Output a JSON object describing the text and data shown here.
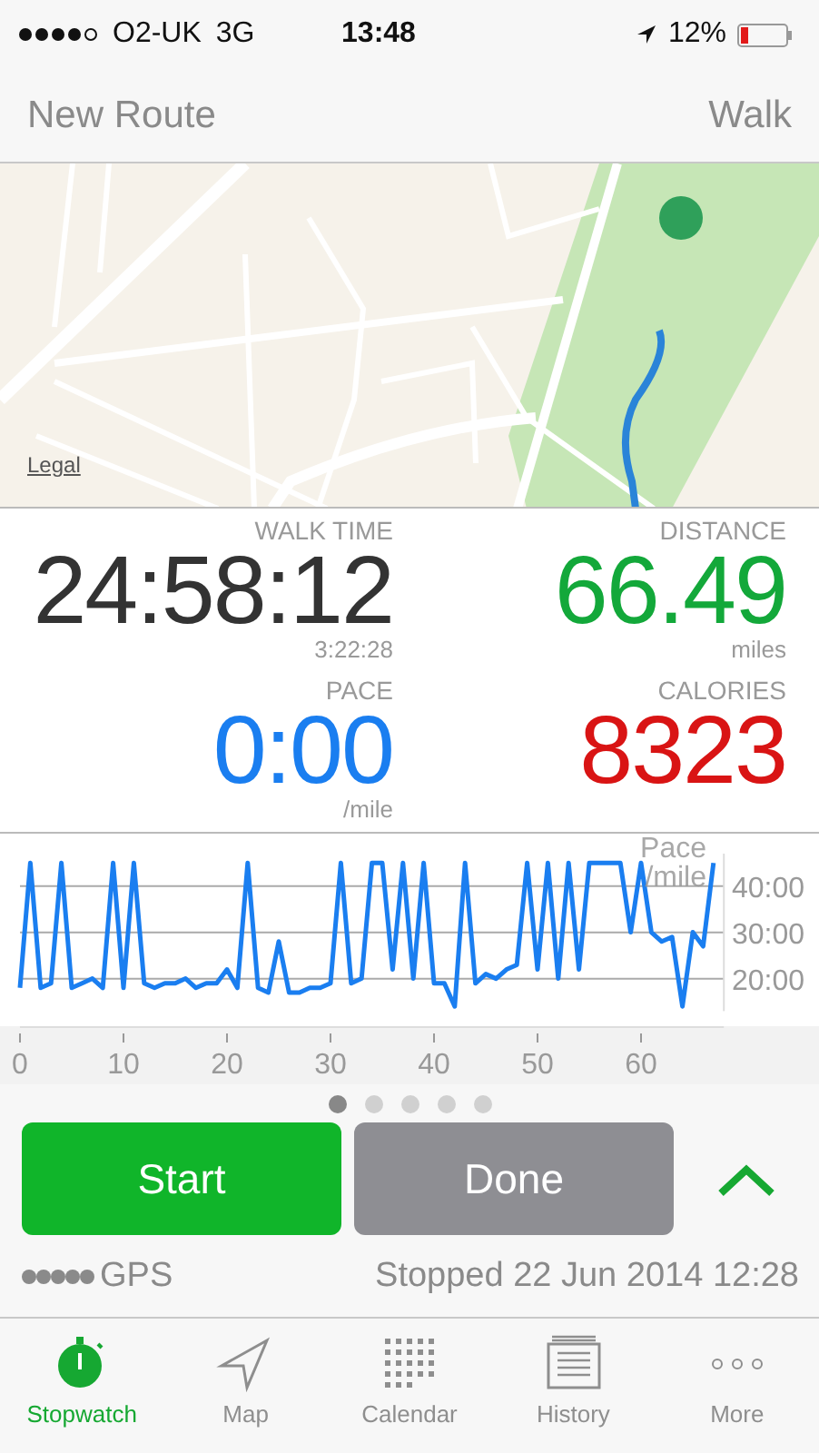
{
  "status_bar": {
    "carrier": "O2-UK",
    "network": "3G",
    "time": "13:48",
    "battery": "12%"
  },
  "nav": {
    "title": "New Route",
    "activity": "Walk"
  },
  "map": {
    "kind": "picture",
    "legal_link": "Legal"
  },
  "stats": [
    {
      "label": "WALK TIME",
      "value": "24:58:12",
      "sub": "3:22:28",
      "color": "#333333"
    },
    {
      "label": "DISTANCE",
      "value": "66.49",
      "sub": "miles",
      "color": "#13a83a"
    },
    {
      "label": "PACE",
      "value": "0:00",
      "sub": "/mile",
      "color": "#1a7ef0"
    },
    {
      "label": "CALORIES",
      "value": "8323",
      "color": "#d91414"
    }
  ],
  "chart": {
    "chart_data": {
      "type": "line",
      "ylabel": "Pace /mile",
      "x": [
        0,
        1,
        2,
        3,
        4,
        5,
        6,
        7,
        8,
        9,
        10,
        11,
        12,
        13,
        14,
        15,
        16,
        17,
        18,
        19,
        20,
        21,
        22,
        23,
        24,
        25,
        26,
        27,
        28,
        29,
        30,
        31,
        32,
        33,
        34,
        35,
        36,
        37,
        38,
        39,
        40,
        41,
        42,
        43,
        44,
        45,
        46,
        47,
        48,
        49,
        50,
        51,
        52,
        53,
        54,
        55,
        56,
        57,
        58,
        59,
        60,
        61,
        62,
        63,
        64,
        65,
        66,
        67
      ],
      "grid": true,
      "series": [
        {
          "color": "#1a7ef0",
          "values": [
            18,
            45,
            18,
            19,
            45,
            18,
            19,
            20,
            18,
            45,
            18,
            45,
            19,
            18,
            19,
            19,
            20,
            18,
            19,
            19,
            22,
            18,
            45,
            18,
            17,
            28,
            17,
            17,
            18,
            18,
            19,
            45,
            19,
            20,
            45,
            45,
            22,
            45,
            20,
            45,
            19,
            19,
            14,
            45,
            19,
            21,
            20,
            22,
            23,
            45,
            22,
            45,
            20,
            45,
            22,
            45,
            45,
            45,
            45,
            30,
            45,
            30,
            28,
            29,
            14,
            30,
            27,
            45
          ]
        }
      ],
      "xlim": [
        0,
        68
      ],
      "ylim": [
        13,
        47
      ],
      "xticks": [
        0,
        10,
        20,
        30,
        40,
        50,
        60
      ],
      "yticks": [
        {
          "value": 20,
          "label": "20:00"
        },
        {
          "value": 30,
          "label": "30:00"
        },
        {
          "value": 40,
          "label": "40:00"
        }
      ]
    }
  },
  "pages": [
    {
      "selected": true
    },
    {
      "selected": false
    },
    {
      "selected": false
    },
    {
      "selected": false
    },
    {
      "selected": false
    }
  ],
  "buttons": [
    {
      "label": "Start",
      "kind": "primary"
    },
    {
      "label": "Done",
      "kind": "secondary"
    }
  ],
  "gps": {
    "label": "GPS",
    "status": "Stopped 22 Jun 2014 12:28"
  },
  "tabs": [
    {
      "label": "Stopwatch",
      "selected": true
    },
    {
      "label": "Map",
      "selected": false
    },
    {
      "label": "Calendar",
      "selected": false
    },
    {
      "label": "History",
      "selected": false
    },
    {
      "label": "More",
      "selected": false
    }
  ]
}
